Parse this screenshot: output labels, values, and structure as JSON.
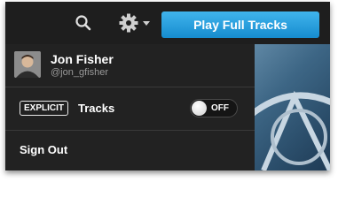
{
  "header": {
    "search_icon": "search-icon",
    "settings_icon": "gear-icon",
    "cta_label": "Play Full Tracks",
    "cta_color": "#2a9fe0"
  },
  "user": {
    "name": "Jon Fisher",
    "handle": "@jon_gfisher"
  },
  "explicit": {
    "badge": "EXPLICIT",
    "label": "Tracks",
    "toggle_state": "OFF"
  },
  "signout": {
    "label": "Sign Out"
  }
}
